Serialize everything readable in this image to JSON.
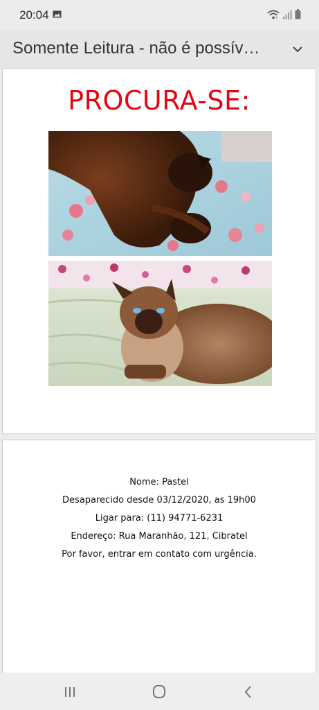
{
  "status_bar": {
    "time": "20:04",
    "icons": [
      "gallery-icon",
      "wifi-icon",
      "signal-icon",
      "battery-icon"
    ]
  },
  "app_bar": {
    "title": "Somente Leitura - não é possível...",
    "menu_icon": "chevron-down-icon"
  },
  "document": {
    "page1": {
      "headline": "PROCURA-SE:",
      "headline_color": "#e30613",
      "photos": [
        "sleeping-siamese-cat-photo",
        "lying-siamese-cat-photo"
      ]
    },
    "page2": {
      "lines": [
        "Nome: Pastel",
        "Desaparecido desde 03/12/2020, as 19h00",
        "Ligar para: (11) 94771-6231",
        "Endereço: Rua Maranhão, 121, Cibratel",
        "Por favor, entrar em contato com urgência."
      ]
    }
  },
  "nav_bar": {
    "buttons": [
      "recent-apps-icon",
      "home-icon",
      "back-icon"
    ]
  }
}
